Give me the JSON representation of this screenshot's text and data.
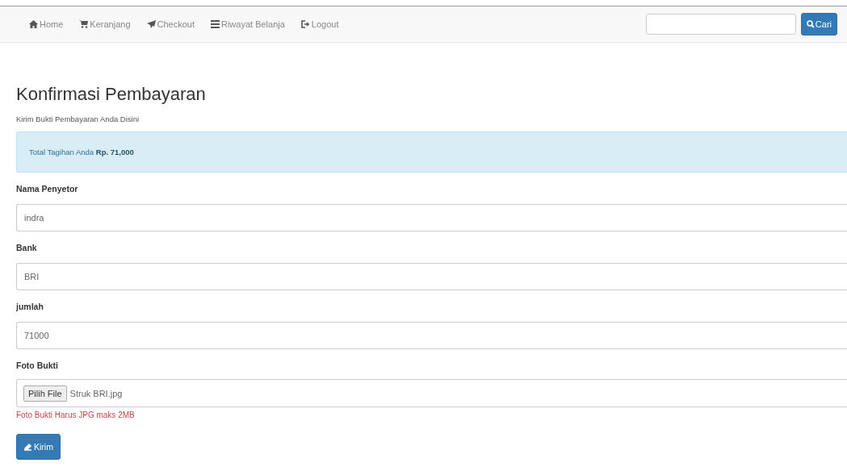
{
  "navbar": {
    "items": [
      {
        "kind": "home",
        "label": "Home"
      },
      {
        "kind": "cart",
        "label": "Keranjang"
      },
      {
        "kind": "send",
        "label": "Checkout"
      },
      {
        "kind": "list",
        "label": "Riwayat Belanja"
      },
      {
        "kind": "logout",
        "label": "Logout"
      }
    ],
    "search": {
      "button": "Cari"
    }
  },
  "page": {
    "title": "Konfirmasi Pembayaran",
    "subtitle": "Kirim Bukti Pembayaran Anda Disini",
    "alert": "Total Tagihan Anda **Rp. 71,000**",
    "fields": [
      {
        "kind": "text",
        "label": "Nama Penyetor",
        "value": "indra"
      },
      {
        "kind": "text",
        "label": "Bank",
        "value": "BRI"
      },
      {
        "kind": "text",
        "label": "jumlah",
        "value": "71000"
      },
      {
        "kind": "file",
        "label": "Foto Bukti",
        "button": "Pilih File",
        "filename": "Struk BRI.jpg",
        "help": "Foto Bukti Harus JPG maks 2MB"
      }
    ],
    "submit": "Kirim"
  }
}
